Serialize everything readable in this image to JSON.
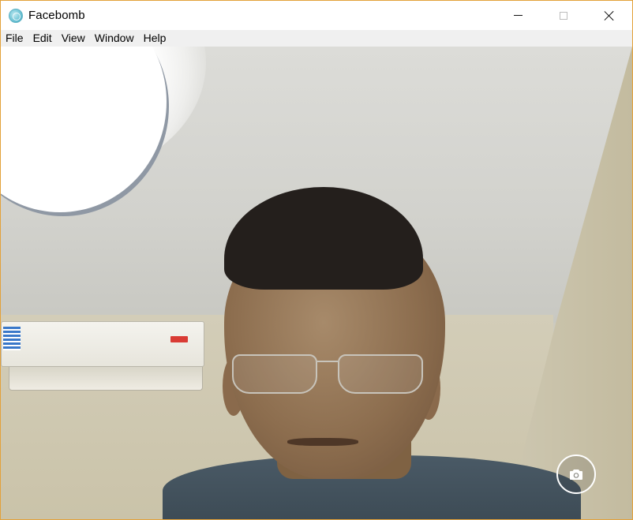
{
  "window": {
    "title": "Facebomb",
    "app_icon": "facebomb-app-icon",
    "controls": {
      "minimize_icon": "minimize-icon",
      "maximize_icon": "maximize-icon",
      "close_icon": "close-icon"
    },
    "border_color": "#e3a13a"
  },
  "menubar": {
    "items": [
      "File",
      "Edit",
      "View",
      "Window",
      "Help"
    ]
  },
  "viewport": {
    "content": "live-webcam-feed",
    "capture_button": {
      "icon": "camera-icon"
    }
  }
}
